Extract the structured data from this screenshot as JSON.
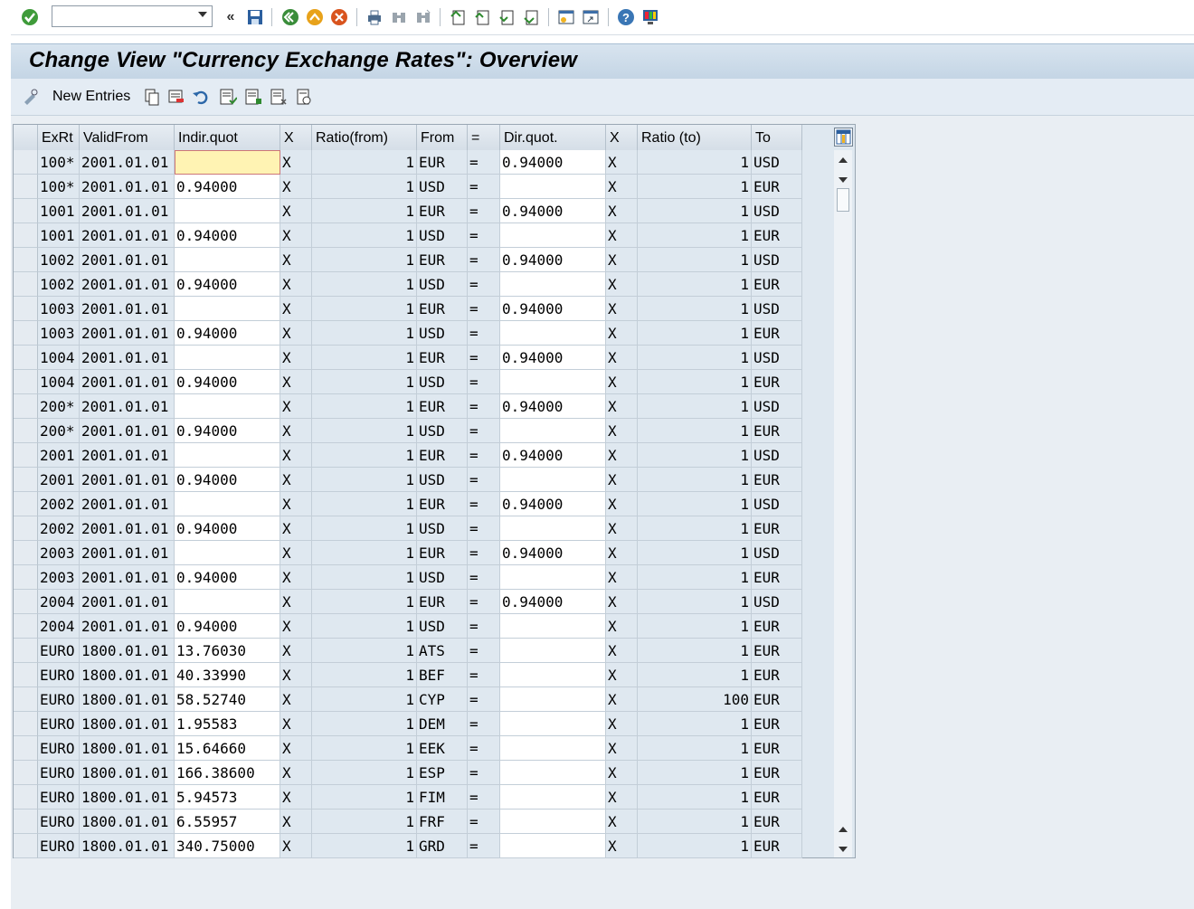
{
  "toolbar": {
    "command_field_value": "",
    "icons": [
      "enter-icon",
      "back-double-icon",
      "save-icon",
      "back-icon",
      "exit-icon",
      "cancel-icon",
      "print-icon",
      "find-icon",
      "find-next-icon",
      "first-page-icon",
      "previous-page-icon",
      "next-page-icon",
      "last-page-icon",
      "create-session-icon",
      "shortcut-icon",
      "help-icon",
      "customize-layout-icon"
    ]
  },
  "title": "Change View \"Currency Exchange Rates\": Overview",
  "app_toolbar": {
    "new_entries": "New Entries",
    "icons": [
      "display-change-icon",
      "copy-as-icon",
      "delete-icon",
      "undo-change-icon",
      "select-all-icon",
      "select-block-icon",
      "deselect-all-icon",
      "choose-icon"
    ]
  },
  "table": {
    "columns": [
      "ExRt",
      "ValidFrom",
      "Indir.quot",
      "X",
      "Ratio(from)",
      "From",
      "=",
      "Dir.quot.",
      "X",
      "Ratio (to)",
      "To"
    ],
    "rows": [
      [
        "100*",
        "2001.01.01",
        "",
        "X",
        "1",
        "EUR",
        "=",
        "0.94000",
        "X",
        "1",
        "USD"
      ],
      [
        "100*",
        "2001.01.01",
        "0.94000",
        "X",
        "1",
        "USD",
        "=",
        "",
        "X",
        "1",
        "EUR"
      ],
      [
        "1001",
        "2001.01.01",
        "",
        "X",
        "1",
        "EUR",
        "=",
        "0.94000",
        "X",
        "1",
        "USD"
      ],
      [
        "1001",
        "2001.01.01",
        "0.94000",
        "X",
        "1",
        "USD",
        "=",
        "",
        "X",
        "1",
        "EUR"
      ],
      [
        "1002",
        "2001.01.01",
        "",
        "X",
        "1",
        "EUR",
        "=",
        "0.94000",
        "X",
        "1",
        "USD"
      ],
      [
        "1002",
        "2001.01.01",
        "0.94000",
        "X",
        "1",
        "USD",
        "=",
        "",
        "X",
        "1",
        "EUR"
      ],
      [
        "1003",
        "2001.01.01",
        "",
        "X",
        "1",
        "EUR",
        "=",
        "0.94000",
        "X",
        "1",
        "USD"
      ],
      [
        "1003",
        "2001.01.01",
        "0.94000",
        "X",
        "1",
        "USD",
        "=",
        "",
        "X",
        "1",
        "EUR"
      ],
      [
        "1004",
        "2001.01.01",
        "",
        "X",
        "1",
        "EUR",
        "=",
        "0.94000",
        "X",
        "1",
        "USD"
      ],
      [
        "1004",
        "2001.01.01",
        "0.94000",
        "X",
        "1",
        "USD",
        "=",
        "",
        "X",
        "1",
        "EUR"
      ],
      [
        "200*",
        "2001.01.01",
        "",
        "X",
        "1",
        "EUR",
        "=",
        "0.94000",
        "X",
        "1",
        "USD"
      ],
      [
        "200*",
        "2001.01.01",
        "0.94000",
        "X",
        "1",
        "USD",
        "=",
        "",
        "X",
        "1",
        "EUR"
      ],
      [
        "2001",
        "2001.01.01",
        "",
        "X",
        "1",
        "EUR",
        "=",
        "0.94000",
        "X",
        "1",
        "USD"
      ],
      [
        "2001",
        "2001.01.01",
        "0.94000",
        "X",
        "1",
        "USD",
        "=",
        "",
        "X",
        "1",
        "EUR"
      ],
      [
        "2002",
        "2001.01.01",
        "",
        "X",
        "1",
        "EUR",
        "=",
        "0.94000",
        "X",
        "1",
        "USD"
      ],
      [
        "2002",
        "2001.01.01",
        "0.94000",
        "X",
        "1",
        "USD",
        "=",
        "",
        "X",
        "1",
        "EUR"
      ],
      [
        "2003",
        "2001.01.01",
        "",
        "X",
        "1",
        "EUR",
        "=",
        "0.94000",
        "X",
        "1",
        "USD"
      ],
      [
        "2003",
        "2001.01.01",
        "0.94000",
        "X",
        "1",
        "USD",
        "=",
        "",
        "X",
        "1",
        "EUR"
      ],
      [
        "2004",
        "2001.01.01",
        "",
        "X",
        "1",
        "EUR",
        "=",
        "0.94000",
        "X",
        "1",
        "USD"
      ],
      [
        "2004",
        "2001.01.01",
        "0.94000",
        "X",
        "1",
        "USD",
        "=",
        "",
        "X",
        "1",
        "EUR"
      ],
      [
        "EURO",
        "1800.01.01",
        "13.76030",
        "X",
        "1",
        "ATS",
        "=",
        "",
        "X",
        "1",
        "EUR"
      ],
      [
        "EURO",
        "1800.01.01",
        "40.33990",
        "X",
        "1",
        "BEF",
        "=",
        "",
        "X",
        "1",
        "EUR"
      ],
      [
        "EURO",
        "1800.01.01",
        "58.52740",
        "X",
        "1",
        "CYP",
        "=",
        "",
        "X",
        "100",
        "EUR"
      ],
      [
        "EURO",
        "1800.01.01",
        "1.95583",
        "X",
        "1",
        "DEM",
        "=",
        "",
        "X",
        "1",
        "EUR"
      ],
      [
        "EURO",
        "1800.01.01",
        "15.64660",
        "X",
        "1",
        "EEK",
        "=",
        "",
        "X",
        "1",
        "EUR"
      ],
      [
        "EURO",
        "1800.01.01",
        "166.38600",
        "X",
        "1",
        "ESP",
        "=",
        "",
        "X",
        "1",
        "EUR"
      ],
      [
        "EURO",
        "1800.01.01",
        "5.94573",
        "X",
        "1",
        "FIM",
        "=",
        "",
        "X",
        "1",
        "EUR"
      ],
      [
        "EURO",
        "1800.01.01",
        "6.55957",
        "X",
        "1",
        "FRF",
        "=",
        "",
        "X",
        "1",
        "EUR"
      ],
      [
        "EURO",
        "1800.01.01",
        "340.75000",
        "X",
        "1",
        "GRD",
        "=",
        "",
        "X",
        "1",
        "EUR"
      ]
    ]
  }
}
